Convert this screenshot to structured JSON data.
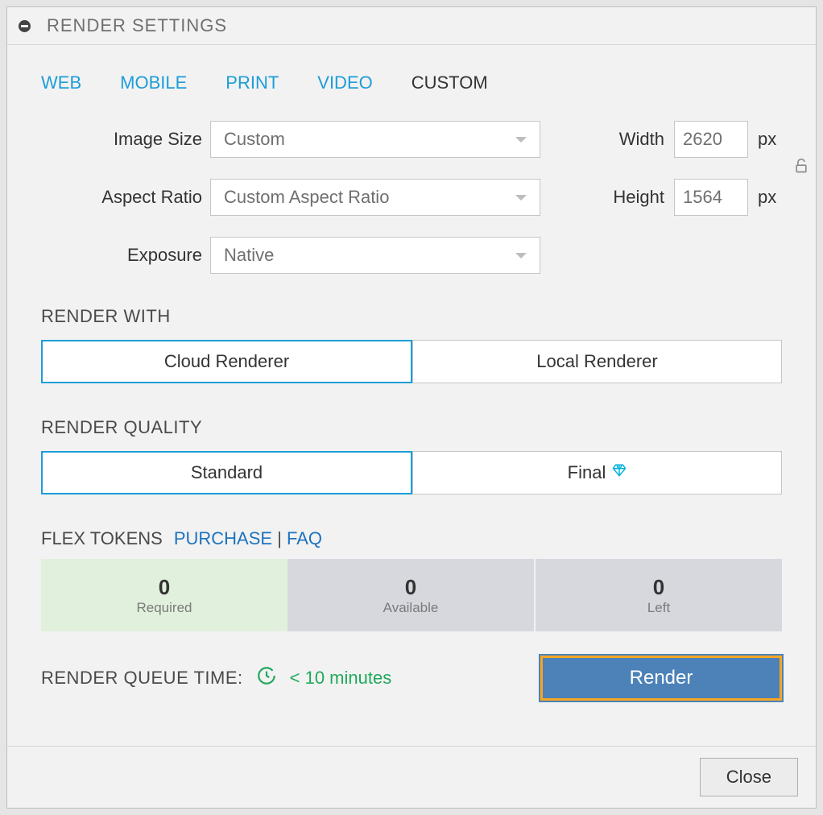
{
  "header": {
    "title": "RENDER SETTINGS"
  },
  "tabs": [
    {
      "label": "WEB",
      "active": false
    },
    {
      "label": "MOBILE",
      "active": false
    },
    {
      "label": "PRINT",
      "active": false
    },
    {
      "label": "VIDEO",
      "active": false
    },
    {
      "label": "CUSTOM",
      "active": true
    }
  ],
  "form": {
    "imageSize": {
      "label": "Image Size",
      "value": "Custom"
    },
    "aspectRatio": {
      "label": "Aspect Ratio",
      "value": "Custom Aspect Ratio"
    },
    "exposure": {
      "label": "Exposure",
      "value": "Native"
    },
    "width": {
      "label": "Width",
      "value": "2620",
      "unit": "px"
    },
    "height": {
      "label": "Height",
      "value": "1564",
      "unit": "px"
    }
  },
  "renderWith": {
    "label": "RENDER WITH",
    "options": [
      "Cloud Renderer",
      "Local Renderer"
    ],
    "selected": 0
  },
  "renderQuality": {
    "label": "RENDER QUALITY",
    "options": [
      "Standard",
      "Final"
    ],
    "selected": 0
  },
  "flexTokens": {
    "label": "FLEX TOKENS",
    "links": {
      "purchase": "PURCHASE",
      "sep": "|",
      "faq": "FAQ"
    },
    "cards": [
      {
        "value": "0",
        "label": "Required"
      },
      {
        "value": "0",
        "label": "Available"
      },
      {
        "value": "0",
        "label": "Left"
      }
    ]
  },
  "queue": {
    "label": "RENDER QUEUE TIME:",
    "time": "< 10 minutes"
  },
  "actions": {
    "render": "Render",
    "close": "Close"
  }
}
